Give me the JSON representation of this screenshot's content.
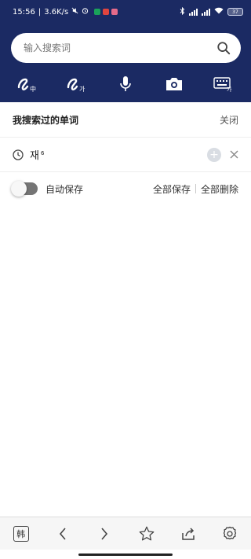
{
  "status_bar": {
    "time": "15:56",
    "net_speed": "3.6K/s",
    "battery": "37",
    "app_dot_colors": [
      "#1aa35a",
      "#e0453f",
      "#e66b8a"
    ]
  },
  "search": {
    "placeholder": "输入搜索词",
    "icon": "search-icon"
  },
  "toolbar": {
    "icons": [
      "handwriting-chinese-icon",
      "handwriting-korean-icon",
      "microphone-icon",
      "camera-icon",
      "korean-keyboard-icon"
    ],
    "hanja_glyph": "中",
    "hangul_glyph": "가"
  },
  "history": {
    "title": "我搜索过的单词",
    "close_label": "关闭",
    "items": [
      {
        "word": "재",
        "superscript": "6"
      }
    ]
  },
  "autosave": {
    "label": "自动保存",
    "enabled": false,
    "save_all_label": "全部保存",
    "delete_all_label": "全部删除"
  },
  "bottom_nav": {
    "lang_label": "韩",
    "icons": [
      "lang-switch-icon",
      "back-arrow-icon",
      "forward-arrow-icon",
      "star-icon",
      "share-icon",
      "settings-icon"
    ]
  },
  "colors": {
    "header_bg": "#1b2a63",
    "toggle_off": "#757575"
  }
}
